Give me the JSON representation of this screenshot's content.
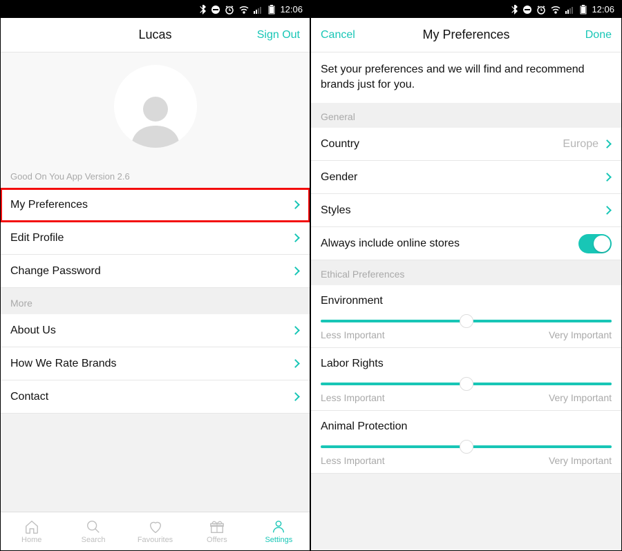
{
  "statusbar": {
    "time": "12:06"
  },
  "left": {
    "nav": {
      "title": "Lucas",
      "right": "Sign Out"
    },
    "version": "Good On You App Version 2.6",
    "rows": {
      "my_preferences": "My Preferences",
      "edit_profile": "Edit Profile",
      "change_password": "Change Password"
    },
    "more_header": "More",
    "more": {
      "about_us": "About Us",
      "how_we_rate": "How We Rate Brands",
      "contact": "Contact"
    },
    "tabs": {
      "home": "Home",
      "search": "Search",
      "favourites": "Favourites",
      "offers": "Offers",
      "settings": "Settings"
    }
  },
  "right": {
    "nav": {
      "left": "Cancel",
      "title": "My Preferences",
      "right": "Done"
    },
    "intro": "Set your preferences and we will find and recommend brands just for you.",
    "general_header": "General",
    "general": {
      "country_label": "Country",
      "country_value": "Europe",
      "gender_label": "Gender",
      "styles_label": "Styles",
      "online_label": "Always include online stores"
    },
    "ethical_header": "Ethical Preferences",
    "sliders": {
      "env": "Environment",
      "labor": "Labor Rights",
      "animal": "Animal Protection",
      "less": "Less Important",
      "very": "Very Important"
    }
  }
}
